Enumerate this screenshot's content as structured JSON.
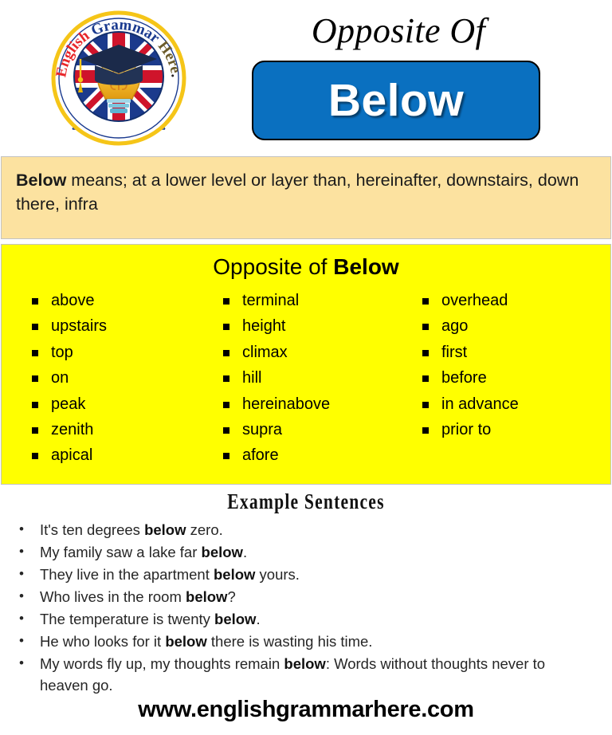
{
  "header": {
    "logo": {
      "icon": "english-grammar-here-logo",
      "ring_text": "English Grammar Here.Com",
      "ring_text_parts": [
        "English ",
        "Grammar ",
        "Here",
        ".Com"
      ],
      "colors": {
        "ring": "#f5c518",
        "text_red": "#e8262a",
        "text_blue": "#1a3a8f",
        "text_black": "#231f20",
        "flag_blue": "#1b3a8c",
        "flag_red": "#cf142b",
        "cap": "#1b2a4a",
        "bulb": "#f4c433"
      }
    },
    "title": "Opposite Of",
    "word": "Below",
    "word_box_color": "#0a70c0"
  },
  "definition": {
    "term": "Below",
    "text": " means; at a lower level or layer than, hereinafter, downstairs, down there, infra",
    "background": "#fce2a0"
  },
  "opposites": {
    "heading_prefix": "Opposite of ",
    "heading_word": "Below",
    "background": "#ffff00",
    "columns": [
      [
        "above",
        "upstairs",
        "top",
        "on",
        "peak",
        "zenith",
        "apical"
      ],
      [
        "terminal",
        "height",
        "climax",
        "hill",
        "hereinabove",
        "supra",
        "afore"
      ],
      [
        "overhead",
        "ago",
        "first",
        "before",
        "in advance",
        "prior to"
      ]
    ]
  },
  "examples": {
    "heading": "Example Sentences",
    "sentences": [
      {
        "pre": "It's ten degrees ",
        "bold": "below",
        "post": " zero."
      },
      {
        "pre": "My family saw a lake far ",
        "bold": "below",
        "post": "."
      },
      {
        "pre": "They live in the apartment ",
        "bold": "below",
        "post": " yours."
      },
      {
        "pre": "Who lives in the room ",
        "bold": "below",
        "post": "?"
      },
      {
        "pre": "The temperature is twenty ",
        "bold": "below",
        "post": "."
      },
      {
        "pre": "He who looks for it ",
        "bold": "below",
        "post": " there is wasting his time."
      },
      {
        "pre": "My words fly up, my thoughts remain ",
        "bold": "below",
        "post": ": Words without thoughts never to heaven go."
      }
    ]
  },
  "footer": {
    "url": "www.englishgrammarhere.com"
  }
}
